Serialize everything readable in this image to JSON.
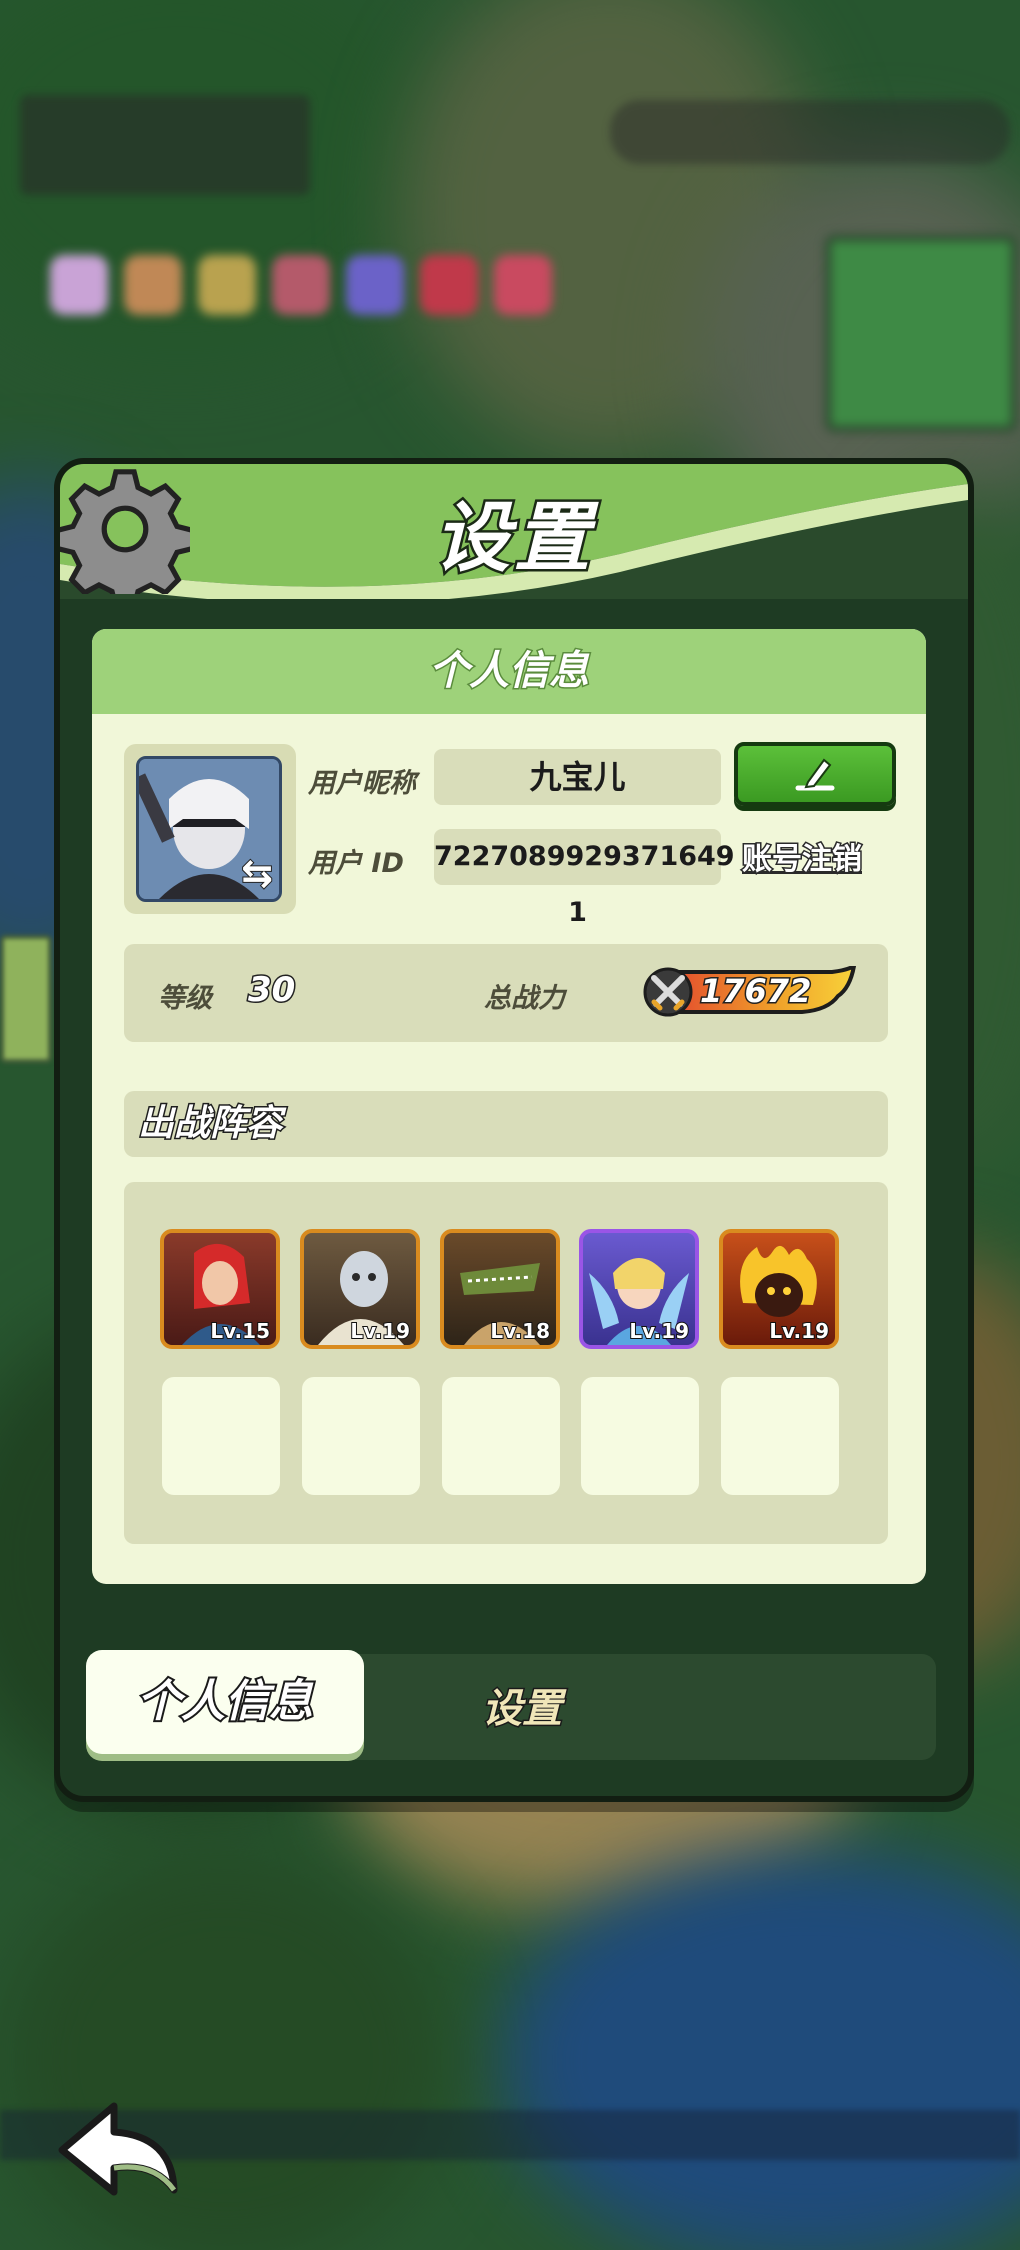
{
  "dialog": {
    "title": "设置",
    "section_title": "个人信息"
  },
  "profile": {
    "nickname_label": "用户昵称",
    "nickname": "九宝儿",
    "id_label": "用户  ID",
    "user_id": "7227089929371649​1",
    "logout_label": "账号注销",
    "level_label": "等级",
    "level": "30",
    "power_label": "总战力",
    "power": "17672"
  },
  "lineup": {
    "title": "出战阵容",
    "heroes": [
      {
        "level_text": "Lv.15",
        "rarity": "orange"
      },
      {
        "level_text": "Lv.19",
        "rarity": "orange"
      },
      {
        "level_text": "Lv.18",
        "rarity": "orange"
      },
      {
        "level_text": "Lv.19",
        "rarity": "purple"
      },
      {
        "level_text": "Lv.19",
        "rarity": "orange"
      }
    ],
    "empty_slots": 5
  },
  "tabs": [
    {
      "label": "个人信息",
      "active": true
    },
    {
      "label": "设置",
      "active": false
    }
  ],
  "colors": {
    "header_green": "#86c25c",
    "card_bg": "#f1f7d9",
    "edit_green": "#4cae2e",
    "frame_orange": "#d98b1f",
    "frame_purple": "#9a55e6"
  },
  "icons": [
    "gear-icon",
    "pencil-icon",
    "swap-icon",
    "crossed-swords-icon",
    "back-arrow-icon"
  ]
}
